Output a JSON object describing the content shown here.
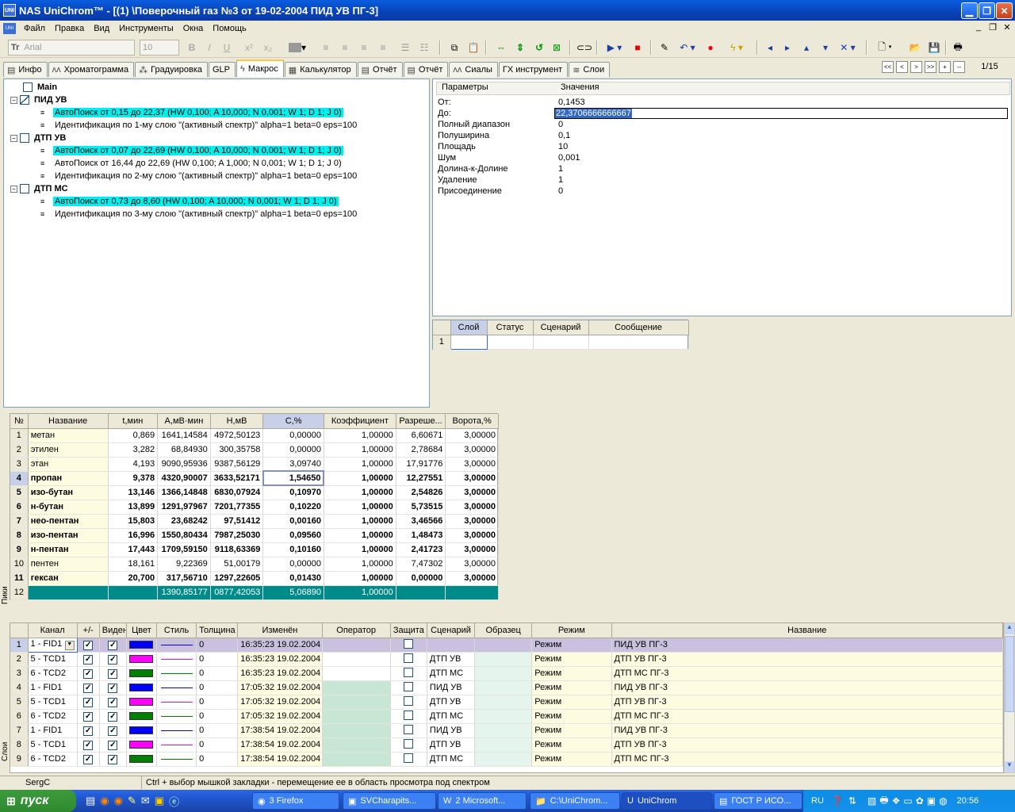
{
  "window": {
    "title": "NAS UniChrom™ - [(1) \\Поверочный газ  №3  от 19-02-2004 ПИД УВ ПГ-3]",
    "app_icon": "UNI"
  },
  "menu": [
    "Файл",
    "Правка",
    "Вид",
    "Инструменты",
    "Окна",
    "Помощь"
  ],
  "toolbar": {
    "font_name": "Arial",
    "font_size": "10",
    "font_icon": "Tr"
  },
  "tabs": [
    {
      "label": "Инфо",
      "icon": "info-icon",
      "glyph": "▤"
    },
    {
      "label": "Хроматограмма",
      "icon": "chromatogram-icon",
      "glyph": "ʌʌ"
    },
    {
      "label": "Градуировка",
      "icon": "calibration-icon",
      "glyph": "⁂"
    },
    {
      "label": "GLP",
      "icon": "",
      "glyph": ""
    },
    {
      "label": "Макрос",
      "icon": "macro-icon",
      "glyph": "ϟ",
      "active": true
    },
    {
      "label": "Калькулятор",
      "icon": "calculator-icon",
      "glyph": "▦"
    },
    {
      "label": "Отчёт",
      "icon": "report-icon",
      "glyph": "▤"
    },
    {
      "label": "Отчёт",
      "icon": "report-icon",
      "glyph": "▤"
    },
    {
      "label": "Сиалы",
      "icon": "signals-icon",
      "glyph": "ʌʌ"
    },
    {
      "label": "ГХ инструмент",
      "icon": "",
      "glyph": ""
    },
    {
      "label": "Слои",
      "icon": "layers-icon",
      "glyph": "≋"
    }
  ],
  "pager": {
    "buttons": [
      "<<",
      "<",
      ">",
      ">>",
      "+",
      "--"
    ],
    "page": "1/15"
  },
  "tree": {
    "root": "Main",
    "groups": [
      {
        "name": "ПИД  УВ",
        "items": [
          {
            "text": "АвтоПоиск от 0,15 до 22,37 (HW 0,100;  A 10,000;  N 0,001; W 1;  D 1;  J 0)",
            "highlight": true
          },
          {
            "text": "Идентификация по 1-му слою \"(активный спектр)\" alpha=1 beta=0 eps=100",
            "highlight": false
          }
        ]
      },
      {
        "name": "ДТП  УВ",
        "items": [
          {
            "text": "АвтоПоиск от 0,07 до 22,69 (HW 0,100;  A 10,000;  N 0,001; W 1;  D 1;  J 0)",
            "highlight": true
          },
          {
            "text": "АвтоПоиск от 16,44 до 22,69 (HW 0,100;  A 1,000;  N 0,001; W 1;  D 1;  J 0)",
            "highlight": false
          },
          {
            "text": "Идентификация по 2-му слою \"(активный спектр)\" alpha=1 beta=0 eps=100",
            "highlight": false
          }
        ]
      },
      {
        "name": "ДТП  МС",
        "items": [
          {
            "text": "АвтоПоиск от 0,73 до 8,60 (HW 0,100;  A 10,000;  N 0,001; W 1;  D 1;  J 0)",
            "highlight": true
          },
          {
            "text": "Идентификация по 3-му слою \"(активный спектр)\" alpha=1 beta=0 eps=100",
            "highlight": false
          }
        ]
      }
    ]
  },
  "params": {
    "headers": [
      "Параметры",
      "Значения"
    ],
    "rows": [
      [
        "От:",
        "0,1453"
      ],
      [
        "До:",
        "22,3706666666667"
      ],
      [
        "Полный диапазон",
        "0"
      ],
      [
        "Полуширина",
        "0,1"
      ],
      [
        "Площадь",
        "10"
      ],
      [
        "Шум",
        "0,001"
      ],
      [
        "Долина-к-Долине",
        "1"
      ],
      [
        "Удаление",
        "1"
      ],
      [
        "Присоединение",
        "0"
      ]
    ]
  },
  "status_grid": {
    "headers": [
      "Слой",
      "Статус",
      "Сценарий",
      "Сообщение"
    ],
    "rows": [
      [
        "1",
        "",
        "",
        "",
        ""
      ]
    ]
  },
  "peaks": {
    "side_label": "Пики",
    "headers": [
      "№",
      "Название",
      "t,мин",
      "A,мВ·мин",
      "H,мВ",
      "C,%",
      "Коэффициент",
      "Разреше...",
      "Ворота,%"
    ],
    "rows": [
      [
        "1",
        "метан",
        "0,869",
        "1641,14584",
        "4972,50123",
        "0,00000",
        "1,00000",
        "6,60671",
        "3,00000"
      ],
      [
        "2",
        "этилен",
        "3,282",
        "68,84930",
        "300,35758",
        "0,00000",
        "1,00000",
        "2,78684",
        "3,00000"
      ],
      [
        "3",
        "этан",
        "4,193",
        "9090,95936",
        "9387,56129",
        "3,09740",
        "1,00000",
        "17,91776",
        "3,00000"
      ],
      [
        "4",
        "пропан",
        "9,378",
        "4320,90007",
        "3633,52171",
        "1,54650",
        "1,00000",
        "12,27551",
        "3,00000"
      ],
      [
        "5",
        "изо-бутан",
        "13,146",
        "1366,14848",
        "6830,07924",
        "0,10970",
        "1,00000",
        "2,54826",
        "3,00000"
      ],
      [
        "6",
        "н-бутан",
        "13,899",
        "1291,97967",
        "7201,77355",
        "0,10220",
        "1,00000",
        "5,73515",
        "3,00000"
      ],
      [
        "7",
        "нео-пентан",
        "15,803",
        "23,68242",
        "97,51412",
        "0,00160",
        "1,00000",
        "3,46566",
        "3,00000"
      ],
      [
        "8",
        "изо-пентан",
        "16,996",
        "1550,80434",
        "7987,25030",
        "0,09560",
        "1,00000",
        "1,48473",
        "3,00000"
      ],
      [
        "9",
        "н-пентан",
        "17,443",
        "1709,59150",
        "9118,63369",
        "0,10160",
        "1,00000",
        "2,41723",
        "3,00000"
      ],
      [
        "10",
        "пентен",
        "18,161",
        "9,22369",
        "51,00179",
        "0,00000",
        "1,00000",
        "7,47302",
        "3,00000"
      ],
      [
        "11",
        "гексан",
        "20,700",
        "317,56710",
        "1297,22605",
        "0,01430",
        "1,00000",
        "0,00000",
        "3,00000"
      ],
      [
        "12",
        "",
        "",
        "1390,85177",
        "0877,42053",
        "5,06890",
        "1,00000",
        "",
        ""
      ]
    ],
    "bold_rows": [
      4,
      5,
      6,
      7,
      8,
      9,
      11
    ]
  },
  "layers": {
    "side_label": "Слои",
    "headers": [
      "",
      "Канал",
      "+/-",
      "Виден",
      "Цвет",
      "Стиль",
      "Толщина",
      "Изменён",
      "Оператор",
      "Защита",
      "Сценарий",
      "Образец",
      "Режим",
      "Название"
    ],
    "rows": [
      {
        "n": "1",
        "channel": "1 - FID1",
        "color": "#0000ff",
        "thickness": "0",
        "changed": "16:35:23 19.02.2004",
        "scenario": "",
        "mode": "Режим",
        "name": "ПИД УВ ПГ-3"
      },
      {
        "n": "2",
        "channel": "5 - TCD1",
        "color": "#ff00ff",
        "thickness": "0",
        "changed": "16:35:23 19.02.2004",
        "scenario": "ДТП  УВ",
        "mode": "Режим",
        "name": "ДТП УВ ПГ-3"
      },
      {
        "n": "3",
        "channel": "6 - TCD2",
        "color": "#008000",
        "thickness": "0",
        "changed": "16:35:23 19.02.2004",
        "scenario": "ДТП  МС",
        "mode": "Режим",
        "name": "ДТП МС ПГ-3"
      },
      {
        "n": "4",
        "channel": "1 - FID1",
        "color": "#0000ff",
        "thickness": "0",
        "changed": "17:05:32 19.02.2004",
        "scenario": "ПИД  УВ",
        "mode": "Режим",
        "name": "ПИД УВ ПГ-3"
      },
      {
        "n": "5",
        "channel": "5 - TCD1",
        "color": "#ff00ff",
        "thickness": "0",
        "changed": "17:05:32 19.02.2004",
        "scenario": "ДТП  УВ",
        "mode": "Режим",
        "name": "ДТП УВ ПГ-3"
      },
      {
        "n": "6",
        "channel": "6 - TCD2",
        "color": "#008000",
        "thickness": "0",
        "changed": "17:05:32 19.02.2004",
        "scenario": "ДТП  МС",
        "mode": "Режим",
        "name": "ДТП МС ПГ-3"
      },
      {
        "n": "7",
        "channel": "1 - FID1",
        "color": "#0000ff",
        "thickness": "0",
        "changed": "17:38:54 19.02.2004",
        "scenario": "ПИД  УВ",
        "mode": "Режим",
        "name": "ПИД УВ ПГ-3"
      },
      {
        "n": "8",
        "channel": "5 - TCD1",
        "color": "#ff00ff",
        "thickness": "0",
        "changed": "17:38:54 19.02.2004",
        "scenario": "ДТП  УВ",
        "mode": "Режим",
        "name": "ДТП УВ ПГ-3"
      },
      {
        "n": "9",
        "channel": "6 - TCD2",
        "color": "#008000",
        "thickness": "0",
        "changed": "17:38:54 19.02.2004",
        "scenario": "ДТП  МС",
        "mode": "Режим",
        "name": "ДТП МС ПГ-3"
      }
    ]
  },
  "statusbar": {
    "user": "SergC",
    "hint": "Ctrl + выбор мышкой закладки - перемещение ее в область просмотра под спектром"
  },
  "taskbar": {
    "start": "пуск",
    "tasks": [
      {
        "label": "3 Firefox",
        "icon": "firefox-icon"
      },
      {
        "label": "SVCharapits...",
        "icon": "app-icon"
      },
      {
        "label": "2 Microsoft...",
        "icon": "word-icon"
      },
      {
        "label": "C:\\UniChrom...",
        "icon": "folder-icon"
      },
      {
        "label": "UniChrom",
        "icon": "unichrom-icon",
        "active": true
      },
      {
        "label": "ГОСТ Р ИСО...",
        "icon": "document-icon"
      }
    ],
    "lang": "RU",
    "clock": "20:56"
  }
}
